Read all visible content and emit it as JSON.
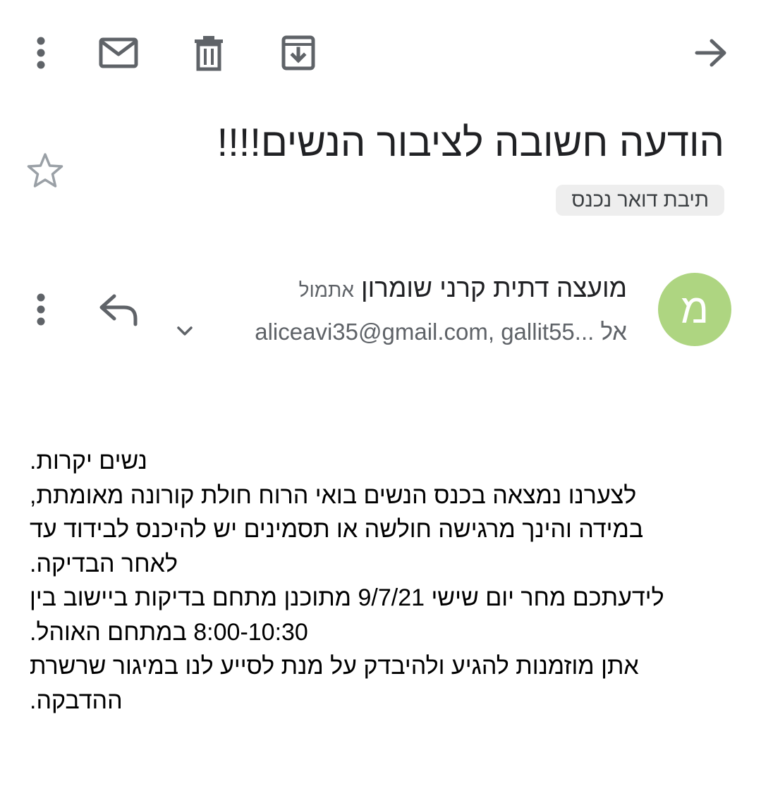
{
  "toolbar": {
    "more_icon": "more-vert-icon",
    "mark_unread_icon": "mail-icon",
    "delete_icon": "trash-icon",
    "archive_icon": "archive-icon",
    "forward_icon": "arrow-right-icon"
  },
  "email": {
    "subject": "הודעה חשובה לציבור הנשים!!!!",
    "label": "תיבת דואר נכנס",
    "starred": false
  },
  "sender": {
    "avatar_letter": "מ",
    "avatar_color": "#aed581",
    "name": "מועצה דתית קרני שומרון",
    "time": "אתמול",
    "to_prefix": "אל",
    "recipients": "aliceavi35@gmail.com, gallit55..."
  },
  "body": {
    "lines": [
      "נשים יקרות.",
      "לצערנו נמצאה בכנס הנשים בואי הרוח חולת קורונה מאומתת,",
      "במידה והינך מרגישה חולשה או תסמינים יש להיכנס לבידוד עד",
      "לאחר הבדיקה.",
      "לידעתכם מחר יום שישי 9/7/21 מתוכנן מתחם בדיקות ביישוב בין",
      "8:00-10:30  במתחם האוהל.",
      "אתן מוזמנות להגיע ולהיבדק על מנת לסייע לנו במיגור שרשרת",
      "ההדבקה."
    ]
  }
}
